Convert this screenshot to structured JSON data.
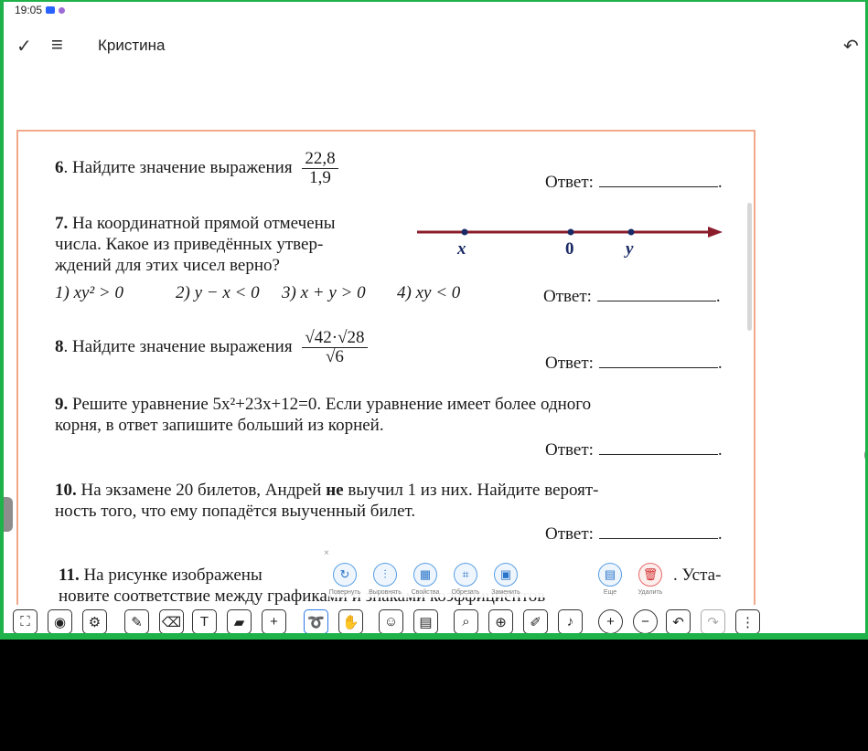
{
  "status": {
    "time": "19:05"
  },
  "appbar": {
    "title": "Кристина"
  },
  "doc": {
    "q6": {
      "num": "6",
      "text": ". Найдите значение выражения",
      "frac_num": "22,8",
      "frac_den": "1,9"
    },
    "q7": {
      "num": "7.",
      "line1": " На координатной прямой отмечены",
      "line2": "числа. Какое из приведённых утвер-",
      "line3": "ждений для этих чисел верно?",
      "opt1": "1) xy² > 0",
      "opt2": "2) y − x < 0",
      "opt3": "3) x + y > 0",
      "opt4": "4) xy < 0",
      "labels": [
        "x",
        "0",
        "y"
      ]
    },
    "q8": {
      "num": "8",
      "text": ". Найдите значение выражения",
      "frac_num": "√42·√28",
      "frac_den": "√6"
    },
    "q9": {
      "num": "9.",
      "line1": " Решите уравнение 5x²+23x+12=0. Если уравнение имеет более одного",
      "line2": "корня, в ответ запишите больший из корней."
    },
    "q10": {
      "num": "10.",
      "line1a": " На экзамене 20 билетов, Андрей ",
      "line1b": "не",
      "line1c": " выучил 1 из них. Найдите вероят-",
      "line2": "ность того, что ему попадётся выученный билет."
    },
    "q11": {
      "num": "11.",
      "line1": " На рисунке изображены",
      "line1end": ". Уста-",
      "line2": "новите соответствие между графиками и знаками коэффициентов"
    },
    "answer_label": "Ответ:",
    "answer_dot": "."
  },
  "float_toolbar": {
    "buttons": [
      {
        "label": "Повернуть",
        "icon": "rotate-icon"
      },
      {
        "label": "Выровнять",
        "icon": "align-icon"
      },
      {
        "label": "Свойства",
        "icon": "properties-icon"
      },
      {
        "label": "Обрезать",
        "icon": "crop-icon"
      },
      {
        "label": "Заменить",
        "icon": "replace-image-icon"
      },
      {
        "label": "Еще",
        "icon": "more-icon"
      },
      {
        "label": "Удалить",
        "icon": "delete-icon"
      }
    ],
    "close": "×"
  },
  "colors": {
    "accent_green": "#1fb14a",
    "doc_border": "#f2a88a",
    "number_line": "#8b1c2b",
    "active_blue": "#2c7be5"
  }
}
